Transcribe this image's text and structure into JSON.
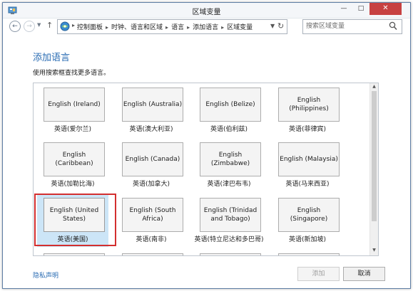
{
  "window": {
    "title": "区域变量"
  },
  "nav": {
    "crumbs": [
      "控制面板",
      "时钟、语言和区域",
      "语言",
      "添加语言",
      "区域变量"
    ],
    "search_placeholder": "搜索区域变量"
  },
  "content": {
    "heading": "添加语言",
    "subtitle": "使用搜索框查找更多语言。"
  },
  "tiles": [
    {
      "label": "English (Ireland)",
      "caption": "英语(爱尔兰)"
    },
    {
      "label": "English (Australia)",
      "caption": "英语(澳大利亚)"
    },
    {
      "label": "English (Belize)",
      "caption": "英语(伯利兹)"
    },
    {
      "label": "English (Philippines)",
      "caption": "英语(菲律宾)"
    },
    {
      "label": "English (Caribbean)",
      "caption": "英语(加勒比海)"
    },
    {
      "label": "English (Canada)",
      "caption": "英语(加拿大)"
    },
    {
      "label": "English (Zimbabwe)",
      "caption": "英语(津巴布韦)"
    },
    {
      "label": "English (Malaysia)",
      "caption": "英语(马来西亚)"
    },
    {
      "label": "English (United States)",
      "caption": "英语(美国)",
      "selected": true
    },
    {
      "label": "English (South Africa)",
      "caption": "英语(南非)"
    },
    {
      "label": "English (Trinidad and Tobago)",
      "caption": "英语(特立尼达和多巴哥)"
    },
    {
      "label": "English (Singapore)",
      "caption": "英语(新加坡)"
    }
  ],
  "footer": {
    "privacy_link": "隐私声明",
    "add_label": "添加",
    "cancel_label": "取消"
  },
  "colors": {
    "accent": "#2a6cb3",
    "selection": "#cce5f7",
    "highlight_border": "#d32f2f"
  },
  "icons": [
    "control-panel-icon",
    "back-arrow-icon",
    "forward-arrow-icon",
    "up-arrow-icon",
    "refresh-icon",
    "search-icon"
  ]
}
